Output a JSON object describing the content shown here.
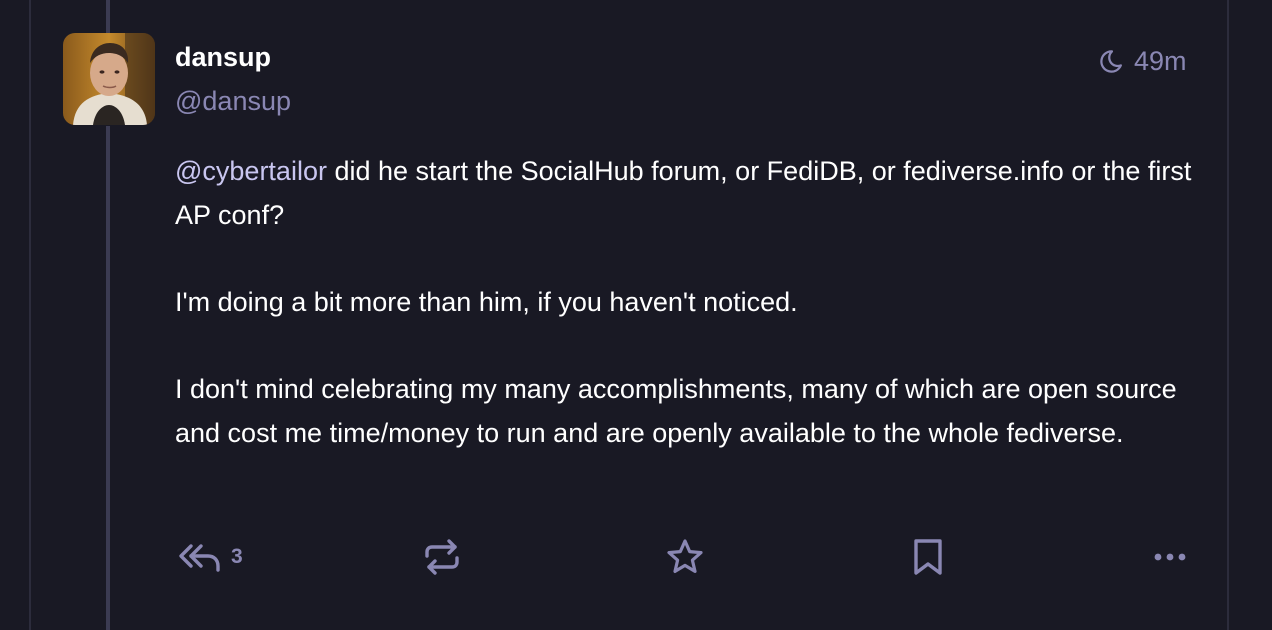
{
  "post": {
    "author": {
      "display_name": "dansup",
      "handle": "@dansup"
    },
    "visibility_icon": "moon-icon",
    "timestamp": "49m",
    "content": {
      "mention": "@cybertailor",
      "paragraph1_rest": " did he start the SocialHub forum, or FediDB, or fediverse.info or the first AP conf?",
      "paragraph2": "I'm doing a bit more than him, if you haven't noticed.",
      "paragraph3": "I don't mind celebrating my many accomplishments, many of which are open source and cost me time/money to run and are openly available to the whole fediverse."
    },
    "actions": {
      "reply_count": "3",
      "reply_icon": "reply-all-icon",
      "boost_icon": "boost-icon",
      "favourite_icon": "star-icon",
      "bookmark_icon": "bookmark-icon",
      "more_icon": "more-icon"
    }
  },
  "colors": {
    "background": "#191924",
    "text": "#ffffff",
    "secondary_text": "#8a87b3",
    "mention": "#c9c6f0",
    "thread_line": "#3b3b52"
  }
}
